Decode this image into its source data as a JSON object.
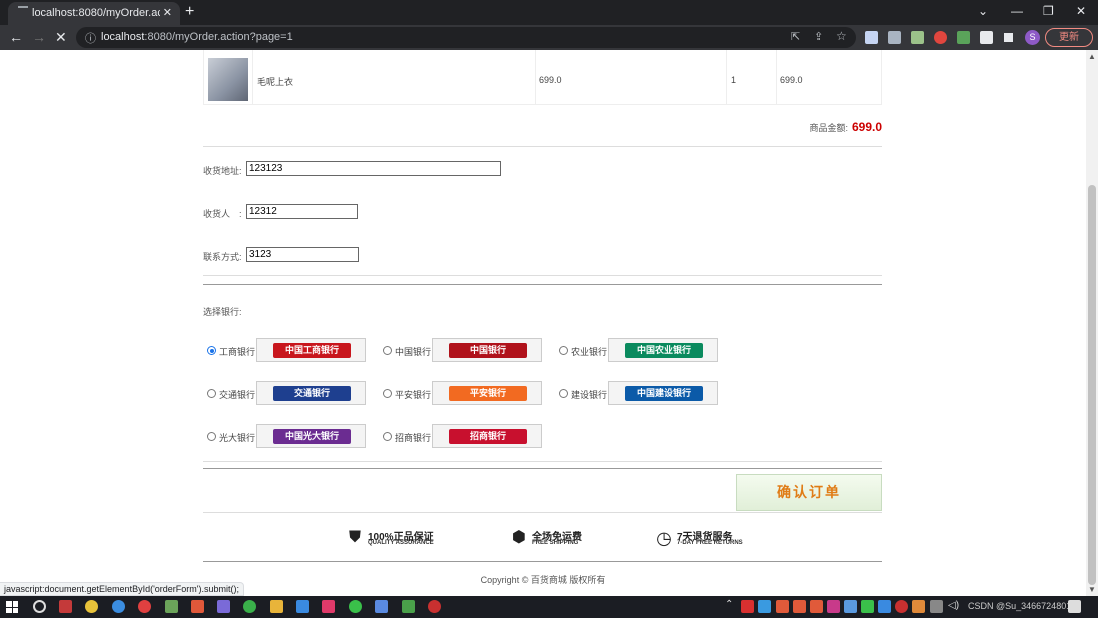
{
  "browser": {
    "tab_title": "localhost:8080/myOrder.actio",
    "url_host": "localhost",
    "url_rest": ":8080/myOrder.action?page=1",
    "avatar_letter": "S",
    "update_label": "更新"
  },
  "order": {
    "product_name": "毛呢上衣",
    "price": "699.0",
    "quantity": "1",
    "subtotal": "699.0",
    "total_label": "商品金额:",
    "total_amount": "699.0"
  },
  "form": {
    "address_label": "收货地址:",
    "address_value": "123123",
    "receiver_label": "收货人　:",
    "receiver_value": "12312",
    "phone_label": "联系方式:",
    "phone_value": "3123"
  },
  "bank_section": {
    "label": "选择银行:",
    "banks": [
      {
        "name": "工商银行",
        "logo_text": "中国工商银行",
        "color": "#c8161d",
        "selected": true
      },
      {
        "name": "中国银行",
        "logo_text": "中国银行",
        "color": "#b0121b",
        "selected": false
      },
      {
        "name": "农业银行",
        "logo_text": "中国农业银行",
        "color": "#0a8a5e",
        "selected": false
      },
      {
        "name": "交通银行",
        "logo_text": "交通银行",
        "color": "#1e3f8f",
        "selected": false
      },
      {
        "name": "平安银行",
        "logo_text": "平安银行",
        "color": "#f26a21",
        "selected": false
      },
      {
        "name": "建设银行",
        "logo_text": "中国建设银行",
        "color": "#0b5aa8",
        "selected": false
      },
      {
        "name": "光大银行",
        "logo_text": "中国光大银行",
        "color": "#6b2c91",
        "selected": false
      },
      {
        "name": "招商银行",
        "logo_text": "招商银行",
        "color": "#c8102e",
        "selected": false
      }
    ]
  },
  "confirm_label": "确认订单",
  "guarantees": [
    {
      "icon": "shield-icon",
      "title": "100%正品保证",
      "sub": "QUALITY ASSURANCE"
    },
    {
      "icon": "box-icon",
      "title": "全场免运费",
      "sub": "FREE SHIPPING"
    },
    {
      "icon": "clock-icon",
      "title": "7天退货服务",
      "sub": "7-DAY FREE RETURNS"
    }
  ],
  "copyright": "Copyright © 百货商城 版权所有",
  "status_tip": "javascript:document.getElementById('orderForm').submit();",
  "tray_text": "CSDN @Su_3466724801"
}
